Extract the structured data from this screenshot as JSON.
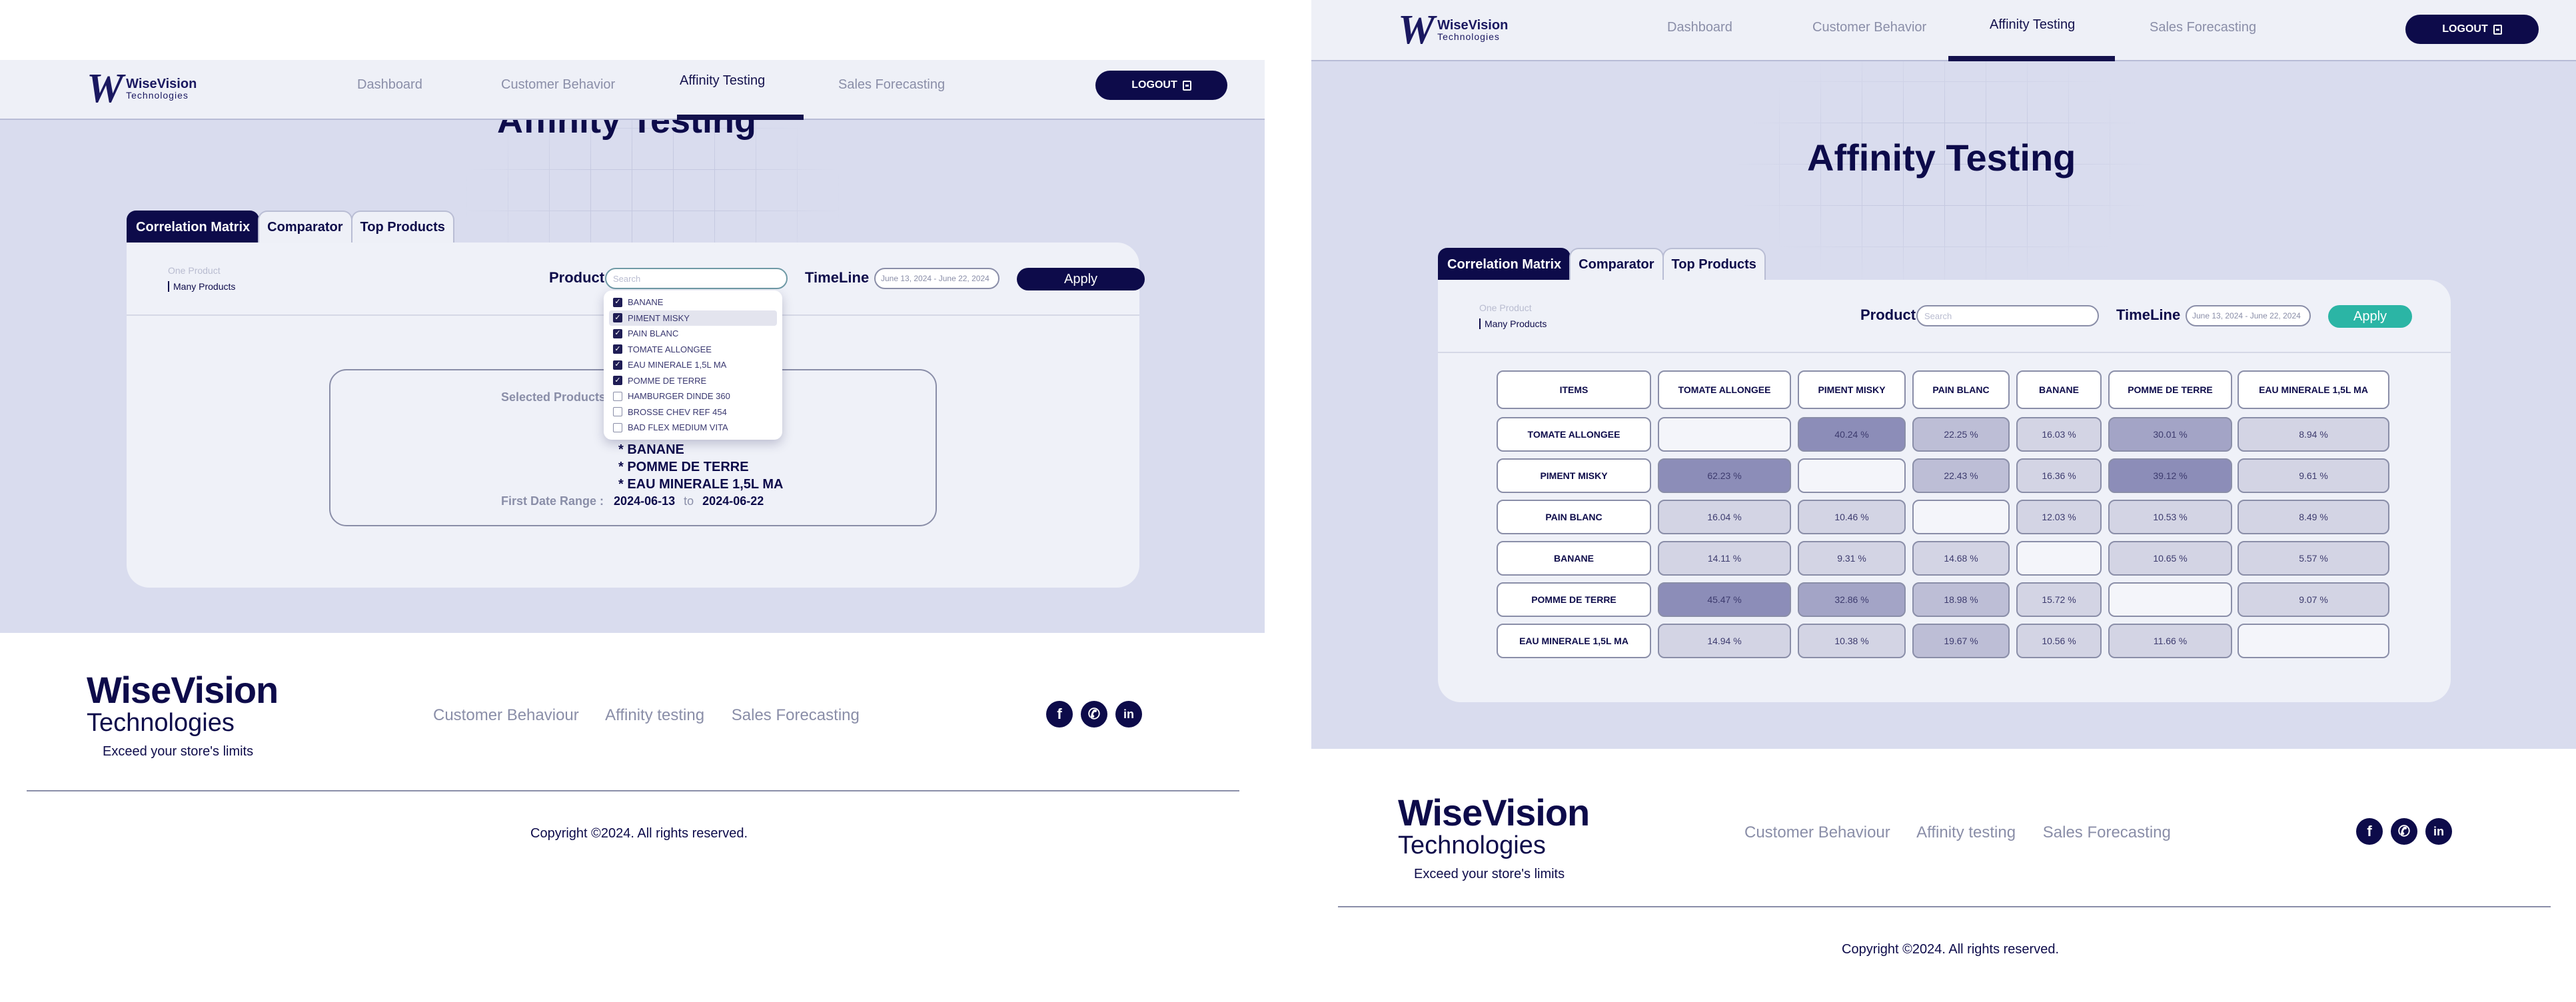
{
  "nav": {
    "logo_main": "WiseVision",
    "logo_sub": "Technologies",
    "items": [
      "Dashboard",
      "Customer Behavior",
      "Affinity Testing",
      "Sales Forecasting"
    ],
    "active": "Affinity Testing",
    "logout": "LOGOUT"
  },
  "page": {
    "title": "Affinity Testing"
  },
  "tabs": [
    "Correlation Matrix",
    "Comparator",
    "Top Products"
  ],
  "filters": {
    "mode_one": "One Product",
    "mode_many": "Many Products",
    "product_label": "Product",
    "search_placeholder": "Search",
    "timeline_label": "TimeLine",
    "date_range": "June 13, 2024 - June 22, 2024",
    "apply": "Apply"
  },
  "dropdown": [
    {
      "label": "BANANE",
      "checked": true
    },
    {
      "label": "PIMENT MISKY",
      "checked": true,
      "highlight": true
    },
    {
      "label": "PAIN BLANC",
      "checked": true
    },
    {
      "label": "TOMATE ALLONGEE",
      "checked": true
    },
    {
      "label": "EAU MINERALE 1,5L MA",
      "checked": true
    },
    {
      "label": "POMME DE TERRE",
      "checked": true
    },
    {
      "label": "HAMBURGER DINDE 360",
      "checked": false
    },
    {
      "label": "BROSSE CHEV REF 454",
      "checked": false
    },
    {
      "label": "BAD FLEX MEDIUM VITA",
      "checked": false
    }
  ],
  "selected": {
    "title": "Selected Products :",
    "items": [
      "* BANANE",
      "* POMME DE TERRE",
      "* EAU MINERALE 1,5L MA"
    ],
    "range_label": "First Date Range :",
    "start": "2024-06-13",
    "to": "to",
    "end": "2024-06-22"
  },
  "matrix": {
    "columns": [
      "ITEMS",
      "TOMATE ALLONGEE",
      "PIMENT MISKY",
      "PAIN BLANC",
      "BANANE",
      "POMME DE TERRE",
      "EAU MINERALE 1,5L MA"
    ],
    "rows": [
      {
        "label": "TOMATE ALLONGEE",
        "values": [
          "",
          "40.24 %",
          "22.25 %",
          "16.03 %",
          "30.01 %",
          "8.94 %"
        ]
      },
      {
        "label": "PIMENT MISKY",
        "values": [
          "62.23 %",
          "",
          "22.43 %",
          "16.36 %",
          "39.12 %",
          "9.61 %"
        ]
      },
      {
        "label": "PAIN BLANC",
        "values": [
          "16.04 %",
          "10.46 %",
          "",
          "12.03 %",
          "10.53 %",
          "8.49 %"
        ]
      },
      {
        "label": "BANANE",
        "values": [
          "14.11 %",
          "9.31 %",
          "14.68 %",
          "",
          "10.65 %",
          "5.57 %"
        ]
      },
      {
        "label": "POMME DE TERRE",
        "values": [
          "45.47 %",
          "32.86 %",
          "18.98 %",
          "15.72 %",
          "",
          "9.07 %"
        ]
      },
      {
        "label": "EAU MINERALE 1,5L MA",
        "values": [
          "14.94 %",
          "10.38 %",
          "19.67 %",
          "10.56 %",
          "11.66 %",
          ""
        ]
      }
    ]
  },
  "footer": {
    "logo_main": "WiseVision",
    "logo_sub": "Technologies",
    "tagline": "Exceed your store's limits",
    "links": [
      "Customer Behaviour",
      "Affinity testing",
      "Sales Forecasting"
    ],
    "social": [
      "f",
      "✆",
      "in"
    ],
    "copyright": "Copyright ©2024. All rights reserved."
  },
  "colors": {
    "primary": "#0d0b4a",
    "teal": "#2bb5a5",
    "bg": "#d9dcee",
    "card": "#eff1f8"
  }
}
